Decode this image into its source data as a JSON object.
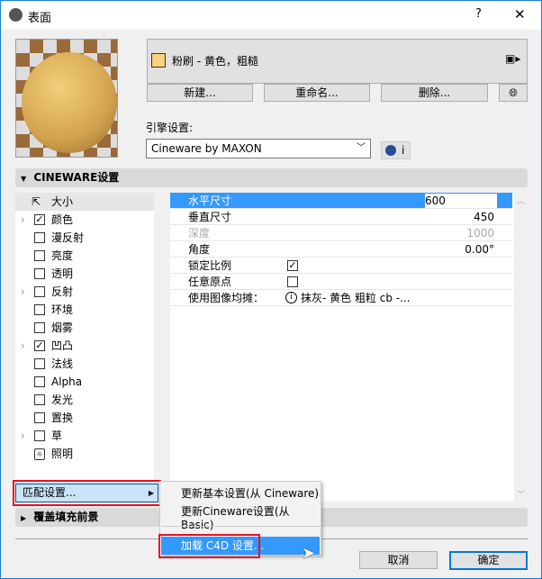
{
  "window": {
    "title": "表面",
    "help": "?",
    "close": "✕"
  },
  "material": {
    "name": "粉刷 - 黄色，粗糙",
    "swatch_color": "#fdd07c"
  },
  "buttons": {
    "new": "新建...",
    "rename": "重命名...",
    "delete": "删除..."
  },
  "engine": {
    "label": "引擎设置:",
    "value": "Cineware by MAXON",
    "info": "i"
  },
  "cineware_section": {
    "title": "CINEWARE设置"
  },
  "channels": [
    {
      "label": "大小",
      "type": "size",
      "checked": false,
      "expand": false
    },
    {
      "label": "颜色",
      "checked": true,
      "expand": true
    },
    {
      "label": "漫反射",
      "checked": false,
      "expand": false
    },
    {
      "label": "亮度",
      "checked": false,
      "expand": false
    },
    {
      "label": "透明",
      "checked": false,
      "expand": false
    },
    {
      "label": "反射",
      "checked": false,
      "expand": true
    },
    {
      "label": "环境",
      "checked": false,
      "expand": false
    },
    {
      "label": "烟雾",
      "checked": false,
      "expand": false
    },
    {
      "label": "凹凸",
      "checked": true,
      "expand": true
    },
    {
      "label": "法线",
      "checked": false,
      "expand": false
    },
    {
      "label": "Alpha",
      "checked": false,
      "expand": false
    },
    {
      "label": "发光",
      "checked": false,
      "expand": false
    },
    {
      "label": "置换",
      "checked": false,
      "expand": false
    },
    {
      "label": "草",
      "checked": false,
      "expand": true
    },
    {
      "label": "照明",
      "type": "light",
      "checked": false,
      "expand": false
    }
  ],
  "properties": [
    {
      "label": "水平尺寸",
      "value": "600"
    },
    {
      "label": "垂直尺寸",
      "value": "450"
    },
    {
      "label": "深度",
      "value": "1000"
    },
    {
      "label": "角度",
      "value": "0.00°"
    },
    {
      "label": "锁定比例",
      "checked": true
    },
    {
      "label": "任意原点",
      "checked": false
    },
    {
      "label": "使用图像均摊：",
      "value": "抹灰- 黄色 粗粒 cb -..."
    }
  ],
  "match_button": "匹配设置...",
  "context_menu": [
    "更新基本设置(从 Cineware)",
    "更新Cineware设置(从Basic)",
    "加载 C4D 设置..."
  ],
  "override_section": {
    "title": "覆盖填充前景"
  },
  "footer": {
    "cancel": "取消",
    "ok": "确定"
  },
  "colors": {
    "accent": "#3399ff",
    "highlight_border": "#e81123"
  }
}
